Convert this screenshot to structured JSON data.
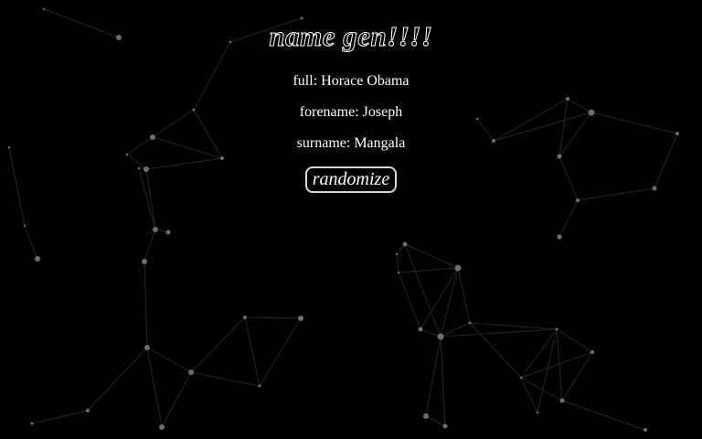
{
  "page": {
    "title": "name gen!!!!"
  },
  "names": {
    "full_label": "full:",
    "full_value": "Horace Obama",
    "forename_label": "forename:",
    "forename_value": "Joseph",
    "surname_label": "surname:",
    "surname_value": "Mangala"
  },
  "actions": {
    "randomize_label": "randomize"
  },
  "colors": {
    "background": "#000000",
    "text": "#ffffff",
    "network_node": "#6e6e6e",
    "network_edge": "#2a2a2a"
  }
}
